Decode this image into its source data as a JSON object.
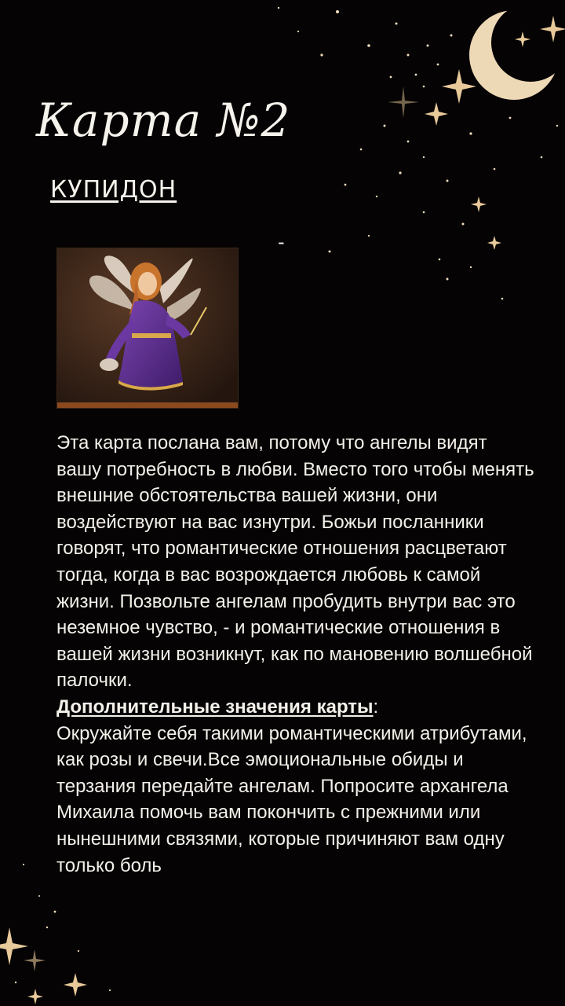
{
  "title": "Карта №2",
  "subtitle": "КУПИДОН",
  "dash": "-",
  "card_image": {
    "description_icon": "angel-illustration",
    "background_color": "#3a2418",
    "robe_color": "#5b2d8a"
  },
  "body": {
    "paragraph": "Эта карта послана вам, потому что ангелы видят вашу потребность в любви. Вместо того чтобы менять внешние обстоятельства вашей жизни, они воздействуют на вас изнутри. Божьи посланники говорят, что романтические отношения расцветают тогда, когда в вас возрождается любовь к самой жизни. Позвольте ангелам пробудить внутри вас это неземное чувство, - и романтические отношения в вашей жизни возникнут, как по мановению волшебной палочки.",
    "extra_heading": "Дополнительные значения карты",
    "extra_colon": ":",
    "extra_text": "Окружайте себя такими романтическими атрибутами, как розы и свечи.Все эмоциональные обиды и терзания передайте ангелам. Попросите архангела Михаила помочь вам покончить с прежними или нынешними связями, которые причиняют вам одну только боль"
  },
  "colors": {
    "background": "#050303",
    "text": "#f4f0ea",
    "accent_gold": "#e8c99a"
  }
}
